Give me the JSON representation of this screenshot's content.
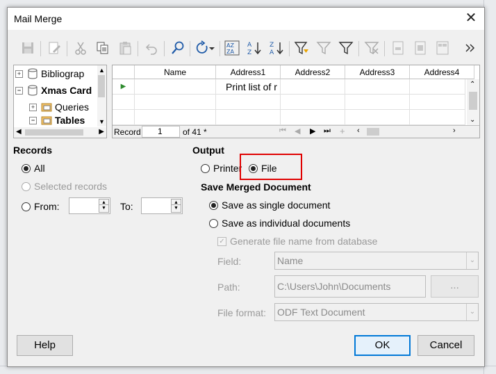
{
  "dialog": {
    "title": "Mail Merge"
  },
  "tree": {
    "items": [
      {
        "label": "Bibliograp",
        "bold": false
      },
      {
        "label": "Xmas Card",
        "bold": true
      },
      {
        "label": "Queries",
        "bold": false
      },
      {
        "label": "Tables",
        "bold": true
      }
    ]
  },
  "grid": {
    "columns": [
      "Name",
      "Address1",
      "Address2",
      "Address3",
      "Address4"
    ],
    "cell_text": "Print list of r",
    "nav": {
      "record_label": "Record",
      "record_value": "1",
      "of_label": "of 41 *"
    }
  },
  "records": {
    "heading": "Records",
    "all": "All",
    "selected": "Selected records",
    "from": "From:",
    "to": "To:"
  },
  "output": {
    "heading": "Output",
    "printer": "Printer",
    "file": "File",
    "save_heading": "Save Merged Document",
    "single": "Save as single document",
    "individual": "Save as individual documents",
    "generate": "Generate file name from database",
    "field_label": "Field:",
    "field_value": "Name",
    "path_label": "Path:",
    "path_value": "C:\\Users\\John\\Documents",
    "browse": "...",
    "format_label": "File format:",
    "format_value": "ODF Text Document"
  },
  "buttons": {
    "help": "Help",
    "ok": "OK",
    "cancel": "Cancel"
  },
  "colors": {
    "highlight": "#e00000",
    "accent": "#0078d7",
    "funnel": "#1e5aa8"
  }
}
